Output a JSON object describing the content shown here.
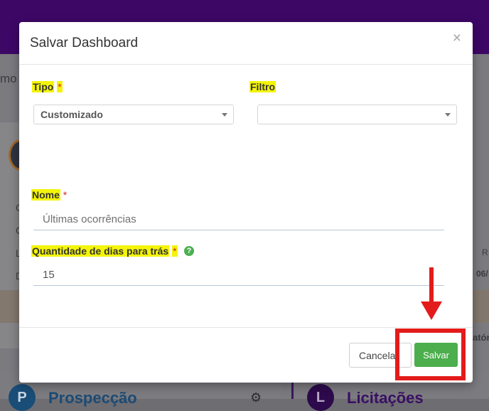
{
  "background": {
    "partial_text_top": "mo",
    "row_letters": [
      "C",
      "C",
      "L",
      "D"
    ],
    "col_header_fragment": "R",
    "date_fragment": "06/",
    "band_fragment": "atór",
    "bottom_left": {
      "circle_letter": "P",
      "title": "Prospecção"
    },
    "bottom_right": {
      "circle_letter": "L",
      "title": "Licitações"
    }
  },
  "modal": {
    "title": "Salvar Dashboard",
    "close_label": "×",
    "tipo": {
      "label": "Tipo",
      "required_mark": "*",
      "selected": "Customizado"
    },
    "filtro": {
      "label": "Filtro",
      "selected": ""
    },
    "nome": {
      "label": "Nome",
      "required_mark": "*",
      "placeholder": "Últimas ocorrências"
    },
    "quantidade": {
      "label": "Quantidade de dias para trás",
      "required_mark": "*",
      "value": "15",
      "help_icon": "?"
    },
    "footer": {
      "cancel_label": "Cancela",
      "save_label": "Salvar"
    }
  },
  "colors": {
    "header_bg": "#3d0766",
    "highlight": "#f4f40a",
    "save_green": "#4cae4c",
    "annotation_red": "#e41b1b",
    "required_red": "#d9261c"
  }
}
